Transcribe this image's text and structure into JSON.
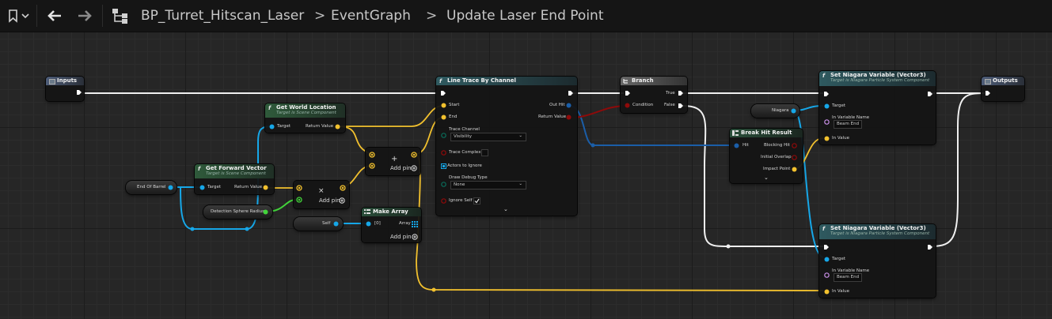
{
  "toolbar": {
    "path_icon": "hierarchy-icon",
    "blueprint": "BP_Turret_Hitscan_Laser",
    "graph": "EventGraph",
    "function": "Update Laser End Point",
    "separator": ">"
  },
  "nodes": {
    "inputs": {
      "title": "Inputs"
    },
    "outputs": {
      "title": "Outputs"
    },
    "get_world_location": {
      "title": "Get World Location",
      "target_is": "Target is Scene Component",
      "target": "Target",
      "return_value": "Return Value"
    },
    "get_forward_vector": {
      "title": "Get Forward Vector",
      "target_is": "Target is Scene Component",
      "target": "Target",
      "return_value": "Return Value"
    },
    "end_of_barrel": {
      "label": "End Of Barrel"
    },
    "detection_sphere_radius": {
      "label": "Detection Sphere Radius"
    },
    "multiply": {
      "symbol": "×",
      "add_pin": "Add pin"
    },
    "add": {
      "symbol": "+",
      "add_pin": "Add pin"
    },
    "self": {
      "label": "Self"
    },
    "make_array": {
      "title": "Make Array",
      "index0": "[0]",
      "array": "Array",
      "add_pin": "Add pin"
    },
    "line_trace": {
      "title": "Line Trace By Channel",
      "start": "Start",
      "end": "End",
      "trace_channel": "Trace Channel",
      "trace_channel_value": "Visibility",
      "trace_complex": "Trace Complex",
      "actors_to_ignore": "Actors to Ignore",
      "draw_debug_type": "Draw Debug Type",
      "draw_debug_value": "None",
      "ignore_self": "Ignore Self",
      "out_hit": "Out Hit",
      "return_value": "Return Value"
    },
    "branch": {
      "title": "Branch",
      "condition": "Condition",
      "true": "True",
      "false": "False"
    },
    "niagara": {
      "label": "Niagara"
    },
    "break_hit": {
      "title": "Break Hit Result",
      "hit": "Hit",
      "blocking_hit": "Blocking Hit",
      "initial_overlap": "Initial Overlap",
      "impact_point": "Impact Point"
    },
    "set_niagara_1": {
      "title": "Set Niagara Variable (Vector3)",
      "target_is": "Target is Niagara Particle System Component",
      "target": "Target",
      "in_variable_name": "In Variable Name",
      "var_value": "Beam End",
      "in_value": "In Value"
    },
    "set_niagara_2": {
      "title": "Set Niagara Variable (Vector3)",
      "target_is": "Target is Niagara Particle System Component",
      "target": "Target",
      "in_variable_name": "In Variable Name",
      "var_value": "Beam End",
      "in_value": "In Value"
    }
  },
  "colors": {
    "exec": "#ffffff",
    "object": "#16a7e8",
    "vector": "#f2c12e",
    "float": "#42d33a",
    "bool": "#8e0a0a",
    "struct": "#1b5ea8",
    "name": "#c88fe6",
    "function_header": "#2f5a3b",
    "pure_header": "#2a4e3a",
    "flow_header": "#555555",
    "event_header": "#4d5c78"
  }
}
